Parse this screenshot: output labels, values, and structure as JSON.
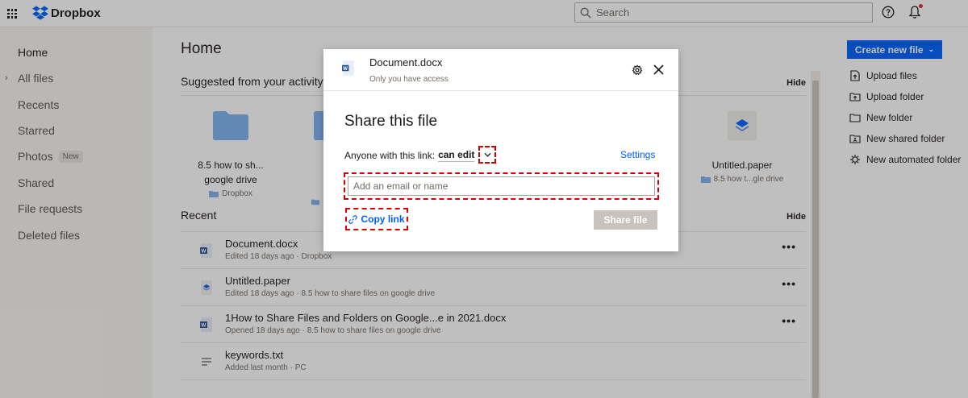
{
  "app": {
    "brand": "Dropbox",
    "accent": "#0061fe"
  },
  "search": {
    "placeholder": "Search"
  },
  "sidebar": {
    "items": [
      {
        "label": "Home",
        "active": true
      },
      {
        "label": "All files"
      },
      {
        "label": "Recents"
      },
      {
        "label": "Starred"
      },
      {
        "label": "Photos",
        "badge": "New"
      },
      {
        "label": "Shared"
      },
      {
        "label": "File requests"
      },
      {
        "label": "Deleted files"
      }
    ]
  },
  "main": {
    "title": "Home",
    "suggested": {
      "title": "Suggested from your activity",
      "hide": "Hide",
      "tiles": [
        {
          "name": "8.5 how to sh... google drive",
          "name_line1": "8.5 how to sh...",
          "name_line2": "google drive",
          "location": "Dropbox",
          "icon": "folder-icon"
        },
        {
          "name": "Untitled.paper",
          "location": "8.5 how t...gle drive",
          "icon": "paper-icon"
        }
      ]
    },
    "recent": {
      "title": "Recent",
      "hide": "Hide",
      "rows": [
        {
          "name": "Document.docx",
          "meta": "Edited 18 days ago · Dropbox",
          "icon": "word-doc-icon"
        },
        {
          "name": "Untitled.paper",
          "meta": "Edited 18 days ago · 8.5 how to share files on google drive",
          "icon": "paper-icon"
        },
        {
          "name": "1How to Share Files and Folders on Google...e in 2021.docx",
          "meta": "Opened 18 days ago · 8.5 how to share files on google drive",
          "icon": "word-doc-icon"
        },
        {
          "name": "keywords.txt",
          "meta": "Added last month · PC",
          "icon": "text-file-icon"
        }
      ]
    }
  },
  "right_panel": {
    "create_label": "Create new file",
    "actions": [
      {
        "label": "Upload files",
        "icon": "upload-file-icon"
      },
      {
        "label": "Upload folder",
        "icon": "upload-folder-icon"
      },
      {
        "label": "New folder",
        "icon": "new-folder-icon"
      },
      {
        "label": "New shared folder",
        "icon": "new-shared-folder-icon"
      },
      {
        "label": "New automated folder",
        "icon": "automated-folder-icon"
      }
    ]
  },
  "modal": {
    "file_name": "Document.docx",
    "access": "Only you have access",
    "title": "Share this file",
    "link_label": "Anyone with this link:",
    "permission": "can edit",
    "settings_label": "Settings",
    "email_placeholder": "Add an email or name",
    "copy_link_label": "Copy link",
    "share_button": "Share file"
  }
}
